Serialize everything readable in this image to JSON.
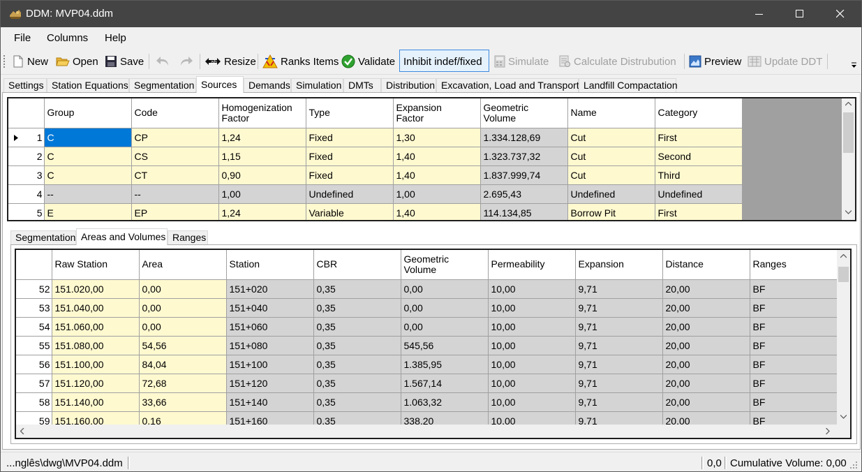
{
  "window": {
    "title": "DDM: MVP04.ddm"
  },
  "menu": [
    "File",
    "Columns",
    "Help"
  ],
  "toolbar": {
    "new": "New",
    "open": "Open",
    "save": "Save",
    "resize": "Resize",
    "ranks": "Ranks Items",
    "validate": "Validate",
    "inhibit": "Inhibit indef/fixed",
    "simulate": "Simulate",
    "calc": "Calculate Distrubution",
    "preview": "Preview",
    "update": "Update DDT"
  },
  "main_tabs": [
    "Settings",
    "Station Equations",
    "Segmentation",
    "Sources",
    "Demands",
    "Simulation",
    "DMTs",
    "Distribution",
    "Excavation, Load and Transport",
    "Landfill Compactation"
  ],
  "sources_grid": {
    "headers": [
      [
        "Group"
      ],
      [
        "Code"
      ],
      [
        "Homogenization",
        "Factor"
      ],
      [
        "Type"
      ],
      [
        "Expansion",
        "Factor"
      ],
      [
        "Geometric",
        "Volume"
      ],
      [
        "Name"
      ],
      [
        "Category"
      ]
    ],
    "rows": [
      {
        "n": "1",
        "cells": [
          "C",
          "CP",
          "1,24",
          "Fixed",
          "1,30",
          "1.334.128,69",
          "Cut",
          "First"
        ]
      },
      {
        "n": "2",
        "cells": [
          "C",
          "CS",
          "1,15",
          "Fixed",
          "1,40",
          "1.323.737,32",
          "Cut",
          "Second"
        ]
      },
      {
        "n": "3",
        "cells": [
          "C",
          "CT",
          "0,90",
          "Fixed",
          "1,40",
          "1.837.999,74",
          "Cut",
          "Third"
        ]
      },
      {
        "n": "4",
        "cells": [
          "--",
          "--",
          "1,00",
          "Undefined",
          "1,00",
          "2.695,43",
          "Undefined",
          "Undefined"
        ]
      },
      {
        "n": "5",
        "cells": [
          "E",
          "EP",
          "1,24",
          "Variable",
          "1,40",
          "114.134,85",
          "Borrow Pit",
          "First"
        ]
      }
    ]
  },
  "sub_tabs": [
    "Segmentation",
    "Areas and Volumes",
    "Ranges"
  ],
  "areas_grid": {
    "headers": [
      [
        "Raw Station"
      ],
      [
        "Area"
      ],
      [
        "Station"
      ],
      [
        "CBR"
      ],
      [
        "Geometric",
        "Volume"
      ],
      [
        "Permeability"
      ],
      [
        "Expansion"
      ],
      [
        "Distance"
      ],
      [
        "Ranges"
      ]
    ],
    "rows": [
      {
        "n": "52",
        "cells": [
          "151.020,00",
          "0,00",
          "151+020",
          "0,35",
          "0,00",
          "10,00",
          "9,71",
          "20,00",
          "BF"
        ]
      },
      {
        "n": "53",
        "cells": [
          "151.040,00",
          "0,00",
          "151+040",
          "0,35",
          "0,00",
          "10,00",
          "9,71",
          "20,00",
          "BF"
        ]
      },
      {
        "n": "54",
        "cells": [
          "151.060,00",
          "0,00",
          "151+060",
          "0,35",
          "0,00",
          "10,00",
          "9,71",
          "20,00",
          "BF"
        ]
      },
      {
        "n": "55",
        "cells": [
          "151.080,00",
          "54,56",
          "151+080",
          "0,35",
          "545,56",
          "10,00",
          "9,71",
          "20,00",
          "BF"
        ]
      },
      {
        "n": "56",
        "cells": [
          "151.100,00",
          "84,04",
          "151+100",
          "0,35",
          "1.385,95",
          "10,00",
          "9,71",
          "20,00",
          "BF"
        ]
      },
      {
        "n": "57",
        "cells": [
          "151.120,00",
          "72,68",
          "151+120",
          "0,35",
          "1.567,14",
          "10,00",
          "9,71",
          "20,00",
          "BF"
        ]
      },
      {
        "n": "58",
        "cells": [
          "151.140,00",
          "33,66",
          "151+140",
          "0,35",
          "1.063,32",
          "10,00",
          "9,71",
          "20,00",
          "BF"
        ]
      },
      {
        "n": "59",
        "cells": [
          "151.160,00",
          "0,16",
          "151+160",
          "0,35",
          "338,20",
          "10,00",
          "9,71",
          "20,00",
          "BF"
        ]
      }
    ]
  },
  "status": {
    "path": "...nglês\\dwg\\MVP04.ddm",
    "coord": "0,0",
    "cumulative": "Cumulative Volume: 0,00"
  }
}
